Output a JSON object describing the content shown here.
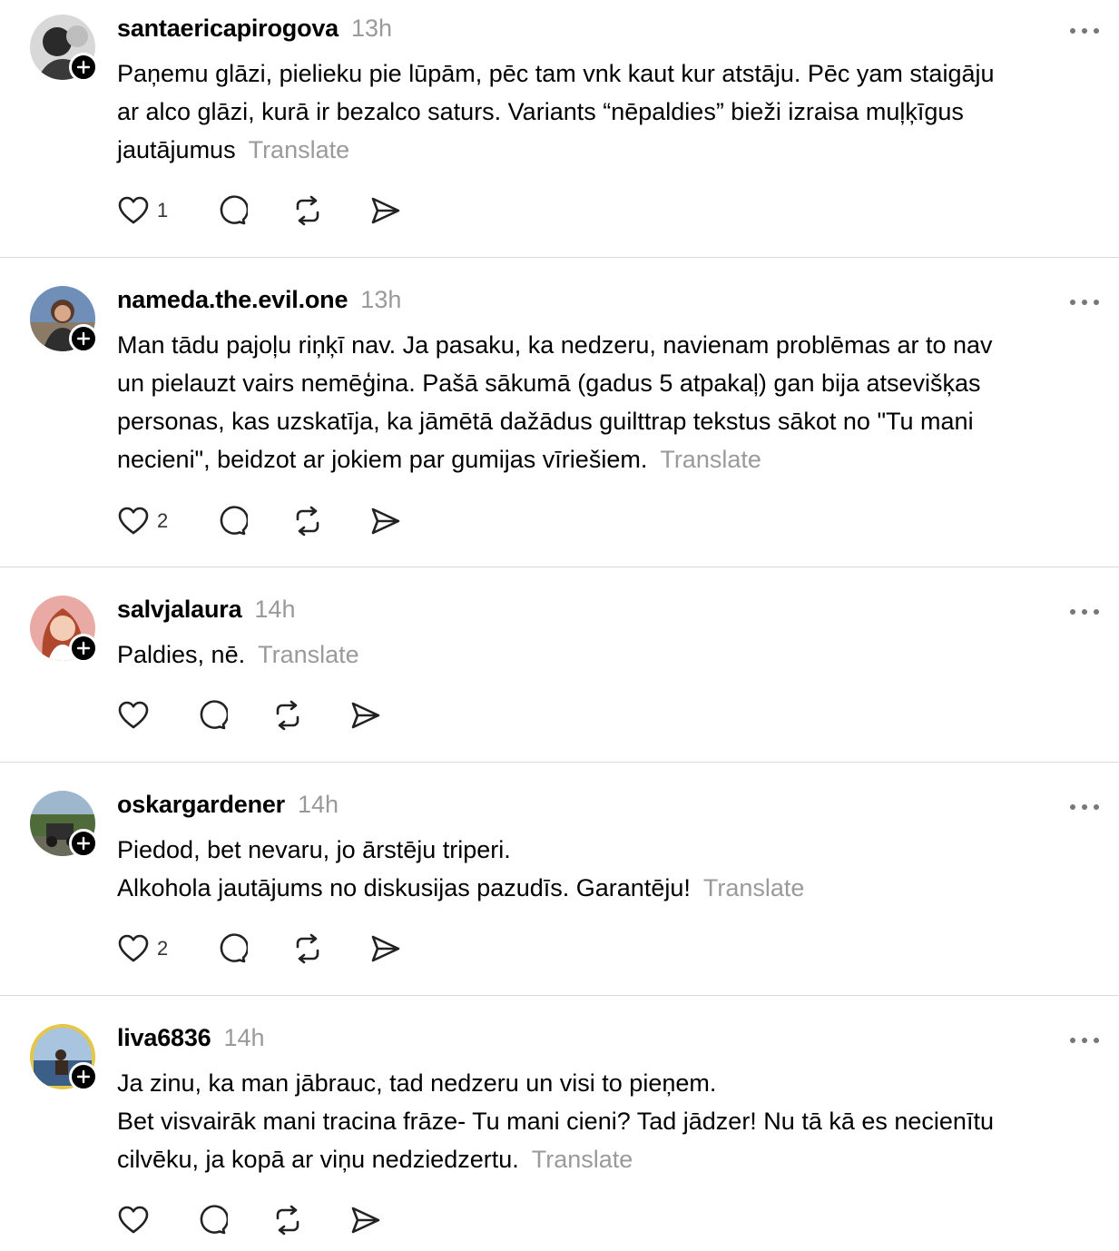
{
  "posts": [
    {
      "username": "santaericapirogova",
      "time": "13h",
      "text": "Paņemu glāzi, pielieku pie lūpām, pēc tam vnk kaut kur atstāju. Pēc yam staigāju\nar alco glāzi, kurā ir bezalco saturs. Variants “nēpaldies” bieži izraisa muļķīgus\njautājumus",
      "translate": "Translate",
      "likes": "1"
    },
    {
      "username": "nameda.the.evil.one",
      "time": "13h",
      "text": "Man tādu pajoļu riņķī nav. Ja pasaku, ka nedzeru, navienam problēmas ar to nav\nun pielauzt vairs nemēģina. Pašā sākumā (gadus 5 atpakaļ) gan bija atsevišķas\npersonas, kas uzskatīja, ka jāmētā dažādus guilttrap tekstus sākot no \"Tu mani\nnecieni\", beidzot ar jokiem par gumijas vīriešiem.",
      "translate": "Translate",
      "likes": "2"
    },
    {
      "username": "salvjalaura",
      "time": "14h",
      "text": "Paldies, nē.",
      "translate": "Translate",
      "likes": ""
    },
    {
      "username": "oskargardener",
      "time": "14h",
      "text": "Piedod, bet nevaru, jo ārstēju triperi.\nAlkohola jautājums no diskusijas pazudīs. Garantēju!",
      "translate": "Translate",
      "likes": "2"
    },
    {
      "username": "liva6836",
      "time": "14h",
      "text": "Ja zinu, ka man jābrauc, tad nedzeru un visi to pieņem.\nBet visvairāk mani tracina frāze- Tu mani cieni? Tad jādzer! Nu tā kā es necienītu\ncilvēku, ja kopā ar viņu nedziedzertu.",
      "translate": "Translate",
      "likes": ""
    }
  ],
  "icons": {
    "like": "heart-icon",
    "reply": "comment-icon",
    "repost": "repost-icon",
    "share": "share-icon",
    "more": "more-icon",
    "follow": "plus-icon"
  },
  "colors": {
    "muted_text": "#9a9a9a",
    "divider": "#d9d9d9",
    "badge": "#000000"
  }
}
